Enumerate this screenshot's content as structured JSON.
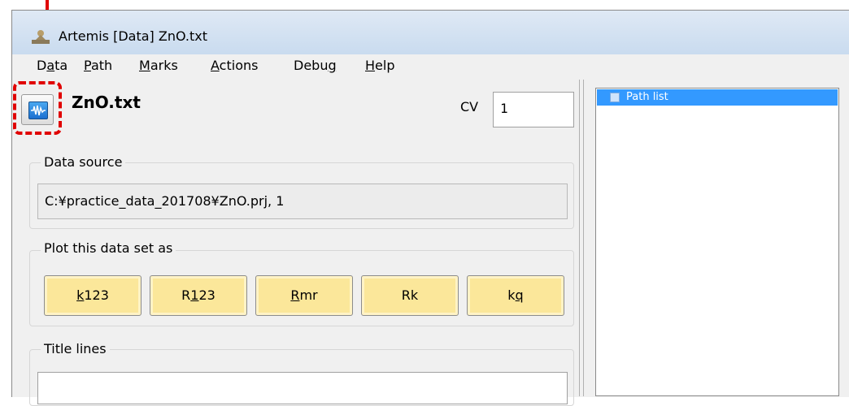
{
  "window": {
    "title": "Artemis [Data] ZnO.txt"
  },
  "menu": [
    {
      "pre": "D",
      "u": "a",
      "post": "ta"
    },
    {
      "pre": "",
      "u": "P",
      "post": "ath"
    },
    {
      "pre": "",
      "u": "M",
      "post": "arks"
    },
    {
      "pre": "",
      "u": "A",
      "post": "ctions"
    },
    {
      "pre": "Debu",
      "u": "g",
      "post": ""
    },
    {
      "pre": "",
      "u": "H",
      "post": "elp"
    }
  ],
  "data_panel": {
    "file_name": "ZnO.txt",
    "cv_label": "CV",
    "cv_value": "1",
    "data_source_label": "Data source",
    "data_source_value": "C:¥practice_data_201708¥ZnO.prj, 1",
    "plot_label": "Plot this data set as",
    "plot_buttons": [
      {
        "pre": "",
        "u": "k",
        "post": "123"
      },
      {
        "pre": "R",
        "u": "1",
        "post": "23"
      },
      {
        "pre": "",
        "u": "R",
        "post": "mr"
      },
      {
        "pre": "Rk",
        "u": "",
        "post": ""
      },
      {
        "pre": "k",
        "u": "q",
        "post": ""
      }
    ],
    "title_lines_label": "Title lines"
  },
  "path_panel": {
    "list_item": "Path list"
  },
  "colors": {
    "annotation": "#e00000",
    "plot_button": "#fbe79a",
    "selection": "#3399ff"
  }
}
